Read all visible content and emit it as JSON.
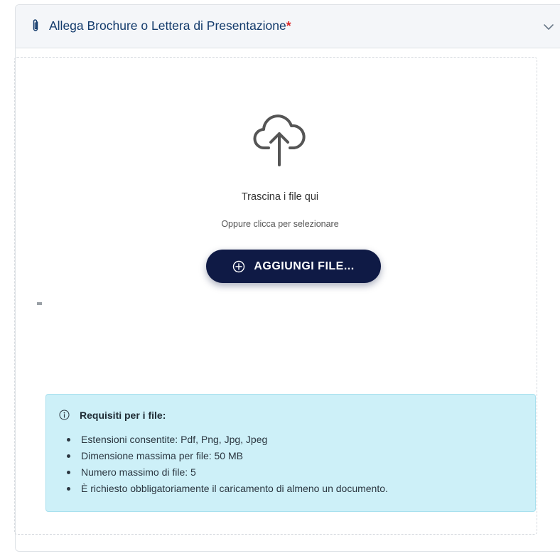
{
  "panel": {
    "title": "Allega Brochure o Lettera di Presentazione",
    "required_marker": "*",
    "icon": "paperclip-icon",
    "toggle_icon": "chevron-down-icon"
  },
  "dropzone": {
    "icon": "cloud-upload-icon",
    "title": "Trascina i file qui",
    "subtitle": "Oppure clicca per selezionare",
    "button": {
      "icon": "plus-circle-icon",
      "label": "AGGIUNGI FILE..."
    }
  },
  "requirements": {
    "icon": "info-icon",
    "title": "Requisiti per i file:",
    "items": [
      "Estensioni consentite: Pdf, Png, Jpg, Jpeg",
      "Dimensione massima per file: 50 MB",
      "Numero massimo di file: 5",
      "È richiesto obbligatoriamente il caricamento di almeno un documento."
    ]
  },
  "colors": {
    "button_bg": "#0f1a45",
    "title_text": "#123a6b",
    "required": "#dc2626",
    "info_bg": "#cdf0f8",
    "header_bg": "#f4f6f9"
  }
}
